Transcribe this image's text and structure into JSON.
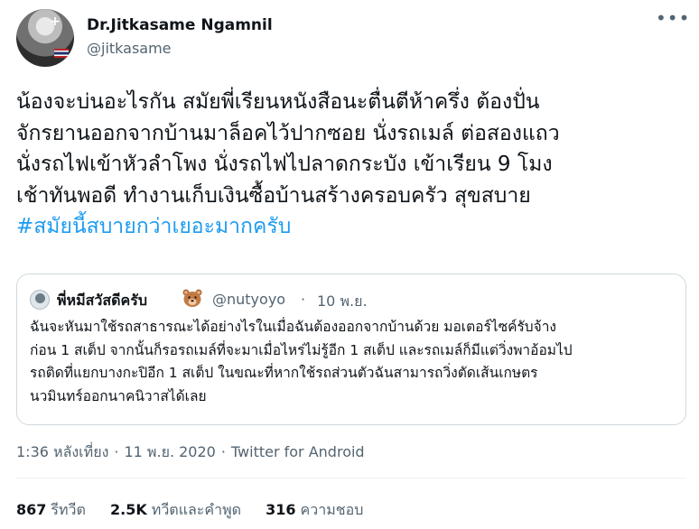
{
  "author": {
    "name": "Dr.Jitkasame Ngamnil",
    "handle": "@jitkasame"
  },
  "more_icon": "•••",
  "tweet": {
    "lines": [
      "น้องจะบ่นอะไรกัน สมัยพี่เรียนหนังสือนะตื่นตีห้าครึ่ง ต้องปั่น",
      "จักรยานออกจากบ้านมาล็อคไว้ปากซอย นั่งรถเมล์ ต่อสองแถว",
      "นั่งรถไฟเข้าหัวลำโพง นั่งรถไฟไปลาดกระบัง เข้าเรียน 9 โมง",
      "เช้าทันพอดี ทำงานเก็บเงินซื้อบ้านสร้างครอบครัว สุขสบาย"
    ],
    "hashtag": "#สมัยนี้สบายกว่าเยอะมากครับ"
  },
  "quoted": {
    "name": "พี่หมีสวัสดีครับ",
    "emoji_icon": "bear-face-icon",
    "handle": "@nutyoyo",
    "separator": "·",
    "date": "10 พ.ย.",
    "lines": [
      "ฉันจะหันมาใช้รถสาธารณะได้อย่างไรในเมื่อฉันต้องออกจากบ้านด้วย มอเตอร์ไซค์รับจ้าง",
      "ก่อน 1 สเต็ป จากนั้นก็รอรถเมล์ที่จะมาเมื่อไหร่ไม่รู้อีก 1 สเต็ป และรถเมล์ก็มีแต่วิ่งพาอ้อมไป",
      "รถติดที่แยกบางกะปิอีก 1 สเต็ป ในขณะที่หากใช้รถส่วนตัวฉันสามารถวิ่งตัดเส้นเกษตร",
      "นวมินทร์ออกนาคนิวาสได้เลย"
    ]
  },
  "meta": {
    "time": "1:36 หลังเที่ยง",
    "separator": "·",
    "date": "11 พ.ย. 2020",
    "source": "Twitter for Android"
  },
  "stats": {
    "retweets_count": "867",
    "retweets_label": "รีทวีต",
    "quotes_count": "2.5K",
    "quotes_label": "ทวีตและคำพูด",
    "likes_count": "316",
    "likes_label": "ความชอบ"
  },
  "colors": {
    "link": "#1d9bf0",
    "secondary_text": "#536471",
    "primary_text": "#0f1419",
    "border": "#cfd9de"
  }
}
